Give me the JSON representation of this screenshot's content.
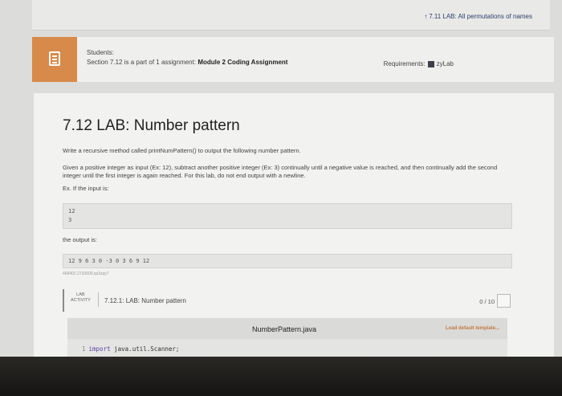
{
  "top_link": "7.11 LAB: All permutations of names",
  "banner": {
    "icon": "book-icon",
    "title": "Students:",
    "text_prefix": "Section 7.12 is a part of 1 assignment:",
    "text_bold": "Module 2 Coding Assignment",
    "requirements_label": "Requirements:",
    "requirements_value": "zyLab"
  },
  "lab": {
    "title": "7.12 LAB: Number pattern",
    "p1": "Write a recursive method called printNumPattern() to output the following number pattern.",
    "p2": "Given a positive integer as input (Ex: 12), subtract another positive integer (Ex: 3) continually until a negative value is reached, and then continually add the second integer until the first integer is again reached. For this lab, do not end output with a newline.",
    "p3": "Ex. If the input is:",
    "input_lines": [
      "12",
      "3"
    ],
    "output_label": "the output is:",
    "output_text": "12 9 6 3 0 -3 0 3 6 9 12",
    "faint_text": "468402.2733600.qx3zqy7",
    "activity_tag_1": "LAB",
    "activity_tag_2": "ACTIVITY",
    "activity_name": "7.12.1: LAB: Number pattern",
    "score": "0 / 10",
    "file_name": "NumberPattern.java",
    "load_template": "Load default template...",
    "code_line_num": "1",
    "code_kw": "import",
    "code_rest": "java.util.Scanner;"
  }
}
